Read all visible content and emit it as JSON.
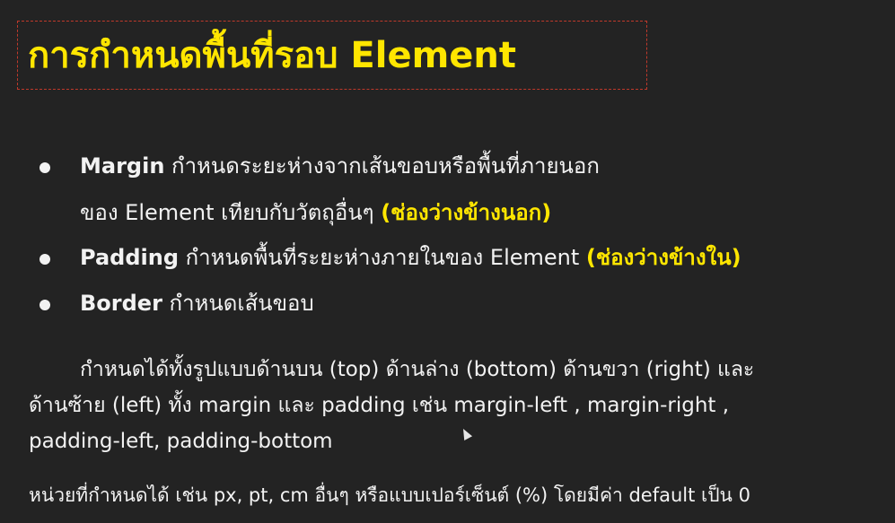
{
  "slide": {
    "title": "การกำหนดพื้นที่รอบ Element",
    "bullets": [
      {
        "term": "Margin",
        "text_line1": " กำหนดระยะห่างจากเส้นขอบหรือพื้นที่ภายนอก",
        "text_line2": "ของ Element เทียบกับวัตถุอื่นๆ ",
        "highlight": "(ช่องว่างข้างนอก)"
      },
      {
        "term": "Padding",
        "text": " กำหนดพื้นที่ระยะห่างภายในของ Element ",
        "highlight": "(ช่องว่างข้างใน)"
      },
      {
        "term": "Border",
        "text": " กำหนดเส้นขอบ"
      }
    ],
    "paragraph": {
      "line1": "กำหนดได้ทั้งรูปแบบด้านบน (top) ด้านล่าง (bottom) ด้านขวา (right) และ",
      "line2": "ด้านซ้าย (left) ทั้ง margin และ padding เช่น margin-left , margin-right ,",
      "line3": "padding-left, padding-bottom"
    },
    "note": "หน่วยที่กำหนดได้ เช่น px, pt, cm อื่นๆ หรือแบบเปอร์เซ็นต์ (%) โดยมีค่า default เป็น 0"
  },
  "colors": {
    "background": "#232323",
    "title": "#ffe600",
    "highlight": "#ffe600",
    "text": "#f2f2f2",
    "title_border": "#c0392b"
  },
  "icons": {
    "cursor": "mouse-pointer-icon",
    "bullet": "bullet-dot-icon"
  }
}
